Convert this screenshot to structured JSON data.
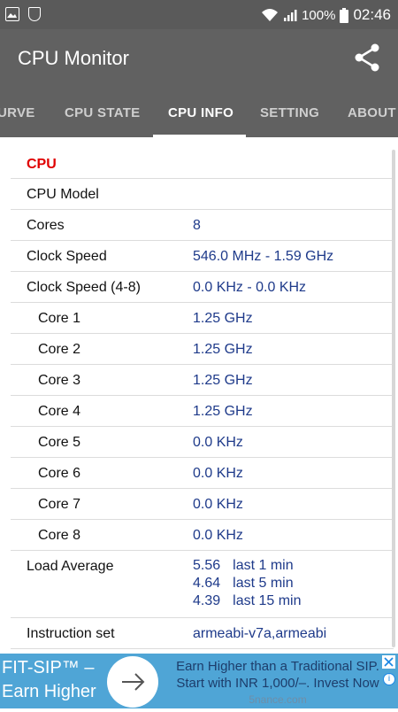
{
  "status_bar": {
    "battery": "100%",
    "time": "02:46"
  },
  "app": {
    "title": "CPU Monitor"
  },
  "tabs": [
    {
      "label": "URVE"
    },
    {
      "label": "CPU STATE"
    },
    {
      "label": "CPU INFO"
    },
    {
      "label": "SETTING"
    },
    {
      "label": "ABOUT"
    }
  ],
  "section": {
    "title": "CPU"
  },
  "rows": [
    {
      "label": "CPU Model",
      "value": ""
    },
    {
      "label": "Cores",
      "value": "8"
    },
    {
      "label": "Clock Speed",
      "value": "546.0 MHz - 1.59 GHz"
    },
    {
      "label": "Clock Speed (4-8)",
      "value": "0.0 KHz - 0.0 KHz"
    },
    {
      "label": "Core 1",
      "value": "1.25 GHz"
    },
    {
      "label": "Core 2",
      "value": "1.25 GHz"
    },
    {
      "label": "Core 3",
      "value": "1.25 GHz"
    },
    {
      "label": "Core 4",
      "value": "1.25 GHz"
    },
    {
      "label": "Core 5",
      "value": "0.0 KHz"
    },
    {
      "label": "Core 6",
      "value": "0.0 KHz"
    },
    {
      "label": "Core 7",
      "value": "0.0 KHz"
    },
    {
      "label": "Core 8",
      "value": "0.0 KHz"
    }
  ],
  "load_average": {
    "label": "Load Average",
    "values": [
      {
        "value": "5.56",
        "period": "last 1 min"
      },
      {
        "value": "4.64",
        "period": "last 5 min"
      },
      {
        "value": "4.39",
        "period": "last 15 min"
      }
    ]
  },
  "instruction_set": {
    "label": "Instruction set",
    "value": "armeabi-v7a,armeabi"
  },
  "ad": {
    "left_line1": "FIT-SIP™ –",
    "left_line2": "Earn Higher",
    "right_line1": "Earn Higher than a Traditional SIP.",
    "right_line2": "Start with INR 1,000/–. Invest Now",
    "domain": "5nance.com"
  },
  "colors": {
    "toolbar": "#616161",
    "status_bar": "#5a5a5a",
    "section_title": "#e00000",
    "value_text": "#1e3a8a",
    "ad_background": "#4fa5d6"
  },
  "icons": [
    "gallery-icon",
    "shield-icon",
    "wifi-icon",
    "signal-icon",
    "battery-icon",
    "share-icon",
    "arrow-right-icon",
    "close-icon",
    "adchoices-icon"
  ]
}
